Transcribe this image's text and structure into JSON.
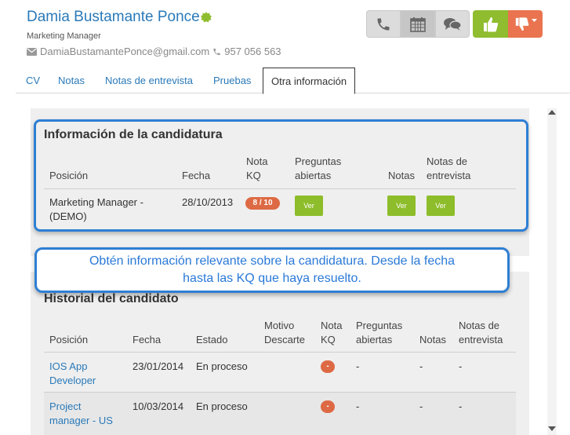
{
  "candidate": {
    "name": "Damia Bustamante Ponce",
    "role": "Marketing Manager",
    "email": "DamiaBustamantePonce@gmail.com",
    "phone": "957 056 563"
  },
  "actions": {
    "icons": [
      "phone-icon",
      "calendar-icon",
      "chat-icon",
      "thumbs-up-icon",
      "thumbs-down-icon"
    ],
    "like_color": "#8fbd2f",
    "dislike_color": "#e9744f"
  },
  "tabs": [
    {
      "label": "CV"
    },
    {
      "label": "Notas"
    },
    {
      "label": "Notas de entrevista"
    },
    {
      "label": "Pruebas"
    },
    {
      "label": "Otra información",
      "active": true
    }
  ],
  "candidatura": {
    "title": "Información de la candidatura",
    "headers": {
      "posicion": "Posición",
      "fecha": "Fecha",
      "nota_kq": [
        "Nota",
        "KQ"
      ],
      "preguntas": [
        "Preguntas",
        "abiertas"
      ],
      "notas": "Notas",
      "notas_entrevista": [
        "Notas de",
        "entrevista"
      ]
    },
    "row": {
      "posicion": [
        "Marketing Manager -",
        "(DEMO)"
      ],
      "fecha": "28/10/2013",
      "kq": "8 / 10",
      "ver_label": "Ver"
    }
  },
  "callout": {
    "line1": "Obtén información relevante sobre la candidatura. Desde la fecha",
    "line2": "hasta las KQ que haya resuelto."
  },
  "historial": {
    "title": "Historial del candidato",
    "headers": {
      "posicion": "Posición",
      "fecha": "Fecha",
      "estado": "Estado",
      "motivo": [
        "Motivo",
        "Descarte"
      ],
      "nota_kq": [
        "Nota",
        "KQ"
      ],
      "preguntas": [
        "Preguntas",
        "abiertas"
      ],
      "notas": "Notas",
      "notas_entrevista": [
        "Notas de",
        "entrevista"
      ]
    },
    "rows": [
      {
        "posicion": [
          "IOS App",
          "Developer"
        ],
        "fecha": "23/01/2014",
        "estado": "En proceso",
        "kq": "-",
        "preguntas": "-",
        "notas": "-",
        "notas_entrevista": "-"
      },
      {
        "posicion": [
          "Project",
          "manager - US"
        ],
        "fecha": "10/03/2014",
        "estado": "En proceso",
        "kq": "-",
        "preguntas": "-",
        "notas": "-",
        "notas_entrevista": "-"
      }
    ]
  },
  "colors": {
    "link": "#2a79b8",
    "highlight": "#2e7fd4",
    "badge": "#dd6a44",
    "ver_button": "#8dbd2a"
  }
}
